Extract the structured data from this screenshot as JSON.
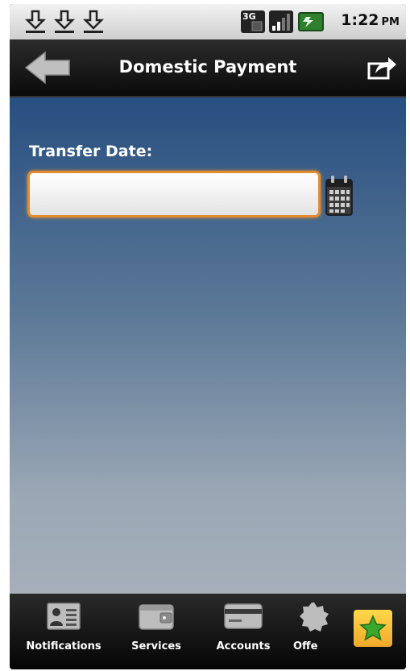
{
  "status_bar": {
    "time": "1:22",
    "ampm": "PM",
    "network_badge": "3G",
    "icons": [
      "download-icon",
      "download-icon",
      "download-icon",
      "network-3g-icon",
      "signal-icon",
      "battery-icon"
    ]
  },
  "header": {
    "title": "Domestic Payment",
    "back_icon": "back-arrow-icon",
    "share_icon": "share-icon"
  },
  "form": {
    "transfer_date_label": "Transfer Date:",
    "transfer_date_value": "",
    "calendar_icon": "calendar-icon"
  },
  "tabs": [
    {
      "label": "Notifications",
      "icon": "id-card-icon"
    },
    {
      "label": "Services",
      "icon": "wallet-icon"
    },
    {
      "label": "Accounts",
      "icon": "credit-card-icon"
    },
    {
      "label": "Offe",
      "icon": "gear-badge-icon"
    },
    {
      "label": "",
      "icon": "star-icon"
    }
  ],
  "colors": {
    "accent_orange": "#e58a2e",
    "content_top": "#274f80",
    "content_bottom": "#a6afba",
    "favorite_yellow": "#f5c33a",
    "star_green": "#3aa82e"
  }
}
